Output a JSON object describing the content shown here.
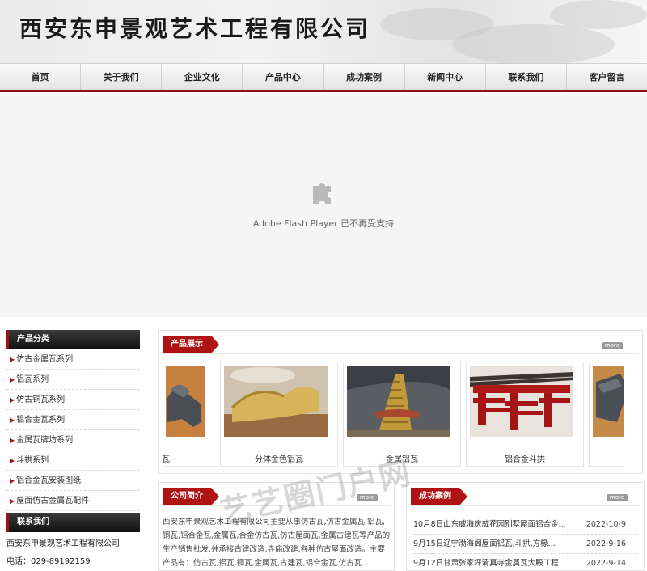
{
  "header": {
    "site_title": "西安东申景观艺术工程有限公司"
  },
  "nav": {
    "items": [
      {
        "label": "首页"
      },
      {
        "label": "关于我们"
      },
      {
        "label": "企业文化"
      },
      {
        "label": "产品中心"
      },
      {
        "label": "成功案例"
      },
      {
        "label": "新闻中心"
      },
      {
        "label": "联系我们"
      },
      {
        "label": "客户留言"
      }
    ]
  },
  "flash": {
    "message": "Adobe Flash Player 已不再受支持",
    "icon": "puzzle-piece-icon"
  },
  "sidebar": {
    "category_title": "产品分类",
    "categories": [
      {
        "label": "仿古金属瓦系列"
      },
      {
        "label": "铝瓦系列"
      },
      {
        "label": "仿古铜瓦系列"
      },
      {
        "label": "铝合金瓦系列"
      },
      {
        "label": "金属瓦牌坊系列"
      },
      {
        "label": "斗拱系列"
      },
      {
        "label": "铝合金瓦安装图纸"
      },
      {
        "label": "屋面仿古金属瓦配件"
      }
    ],
    "contact_title": "联系我们",
    "contact_company": "西安东申景观艺术工程有限公司",
    "contact_phone": "电话：029-89192159"
  },
  "products": {
    "title": "产品展示",
    "more": "more",
    "items": [
      {
        "label": "铝瓦"
      },
      {
        "label": "分体金色铝瓦"
      },
      {
        "label": "金属铝瓦"
      },
      {
        "label": "铝合金斗拱"
      },
      {
        "label": ""
      }
    ]
  },
  "intro": {
    "title": "公司简介",
    "more": "more",
    "text": "西安东申景观艺术工程有限公司主要从事仿古瓦,仿古金属瓦,铝瓦,铜瓦,铝合金瓦,金属瓦,合金仿古瓦,仿古屋面瓦,金属古建瓦等产品的生产销售批发,并承接古建改造,寺庙改建,各种仿古屋面改造。主要产品有：仿古瓦,铝瓦,铜瓦,金属瓦,古建瓦,铝合金瓦,仿古瓦..."
  },
  "cases": {
    "title": "成功案例",
    "more": "more",
    "items": [
      {
        "title": "10月8日山东威海庆威花园别墅屋面铝合金...",
        "date": "2022-10-9"
      },
      {
        "title": "9月15日辽宁渤海阁屋面铝瓦,斗拱,方椽...",
        "date": "2022-9-16"
      },
      {
        "title": "9月12日甘肃张家坪清真寺金属瓦大殿工程",
        "date": "2022-9-14"
      }
    ]
  },
  "watermark": {
    "text": "艺艺圈门户网"
  },
  "colors": {
    "accent": "#b01313",
    "nav_border": "#8c0f0f",
    "dark_head": "#1a1a1a"
  }
}
